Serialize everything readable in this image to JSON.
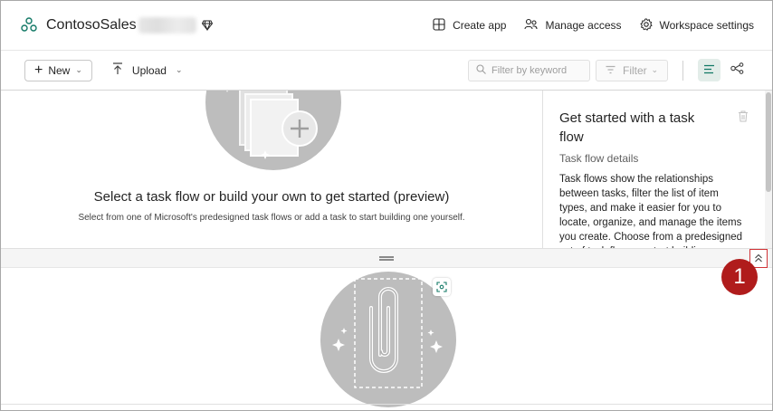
{
  "header": {
    "workspace_name": "ContosoSales",
    "actions": {
      "create_app": "Create app",
      "manage_access": "Manage access",
      "workspace_settings": "Workspace settings"
    }
  },
  "toolbar": {
    "new_label": "New",
    "upload_label": "Upload",
    "filter_placeholder": "Filter by keyword",
    "filter_label": "Filter"
  },
  "empty_state": {
    "title": "Select a task flow or build your own to get started (preview)",
    "subtitle": "Select from one of Microsoft's predesigned task flows or add a task to start building one yourself."
  },
  "side_panel": {
    "title": "Get started with a task flow",
    "subtitle": "Task flow details",
    "body": "Task flows show the relationships between tasks, filter the list of item types, and make it easier for you to locate, organize, and manage the items you create. Choose from a predesigned set of task flows or start building one yourself."
  },
  "callout": {
    "number": "1"
  },
  "colors": {
    "accent": "#117865",
    "callout": "#b01c1c",
    "highlight_border": "#d13438",
    "illustration_gray": "#bdbdbd"
  },
  "icons": {
    "workspace": "workspace-icon",
    "premium": "diamond-icon",
    "create_app": "app-grid-icon",
    "manage_access": "people-icon",
    "workspace_settings": "gear-icon",
    "upload": "upload-arrow-icon",
    "search": "search-icon",
    "filter": "filter-icon",
    "list_view": "list-view-icon",
    "lineage_view": "lineage-icon",
    "delete": "trash-icon",
    "expand": "double-chevron-up-icon",
    "focus": "focus-icon"
  }
}
